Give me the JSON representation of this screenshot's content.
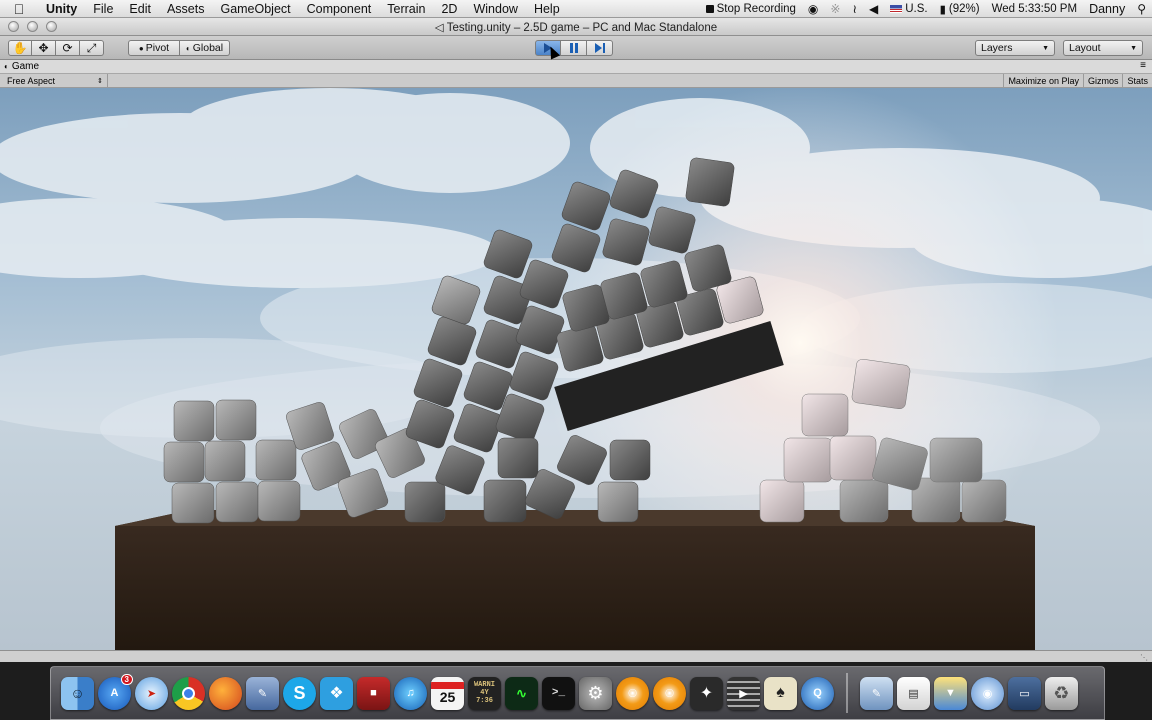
{
  "menubar": {
    "app": "Unity",
    "items": [
      "File",
      "Edit",
      "Assets",
      "GameObject",
      "Component",
      "Terrain",
      "2D",
      "Window",
      "Help"
    ],
    "recording": "Stop Recording",
    "input_source": "U.S.",
    "battery": "(92%)",
    "clock": "Wed 5:33:50 PM",
    "user": "Danny"
  },
  "window": {
    "title": "Testing.unity – 2.5D game – PC and Mac Standalone"
  },
  "toolbar": {
    "pivot": "Pivot",
    "global": "Global",
    "layers": "Layers",
    "layout": "Layout"
  },
  "game_panel": {
    "tab": "Game",
    "aspect": "Free Aspect",
    "maximize": "Maximize on Play",
    "gizmos": "Gizmos",
    "stats": "Stats"
  },
  "dock": {
    "app_store_badge": "3",
    "calendar_day": "25",
    "console_text": "WARNI 4Y 7:36"
  }
}
